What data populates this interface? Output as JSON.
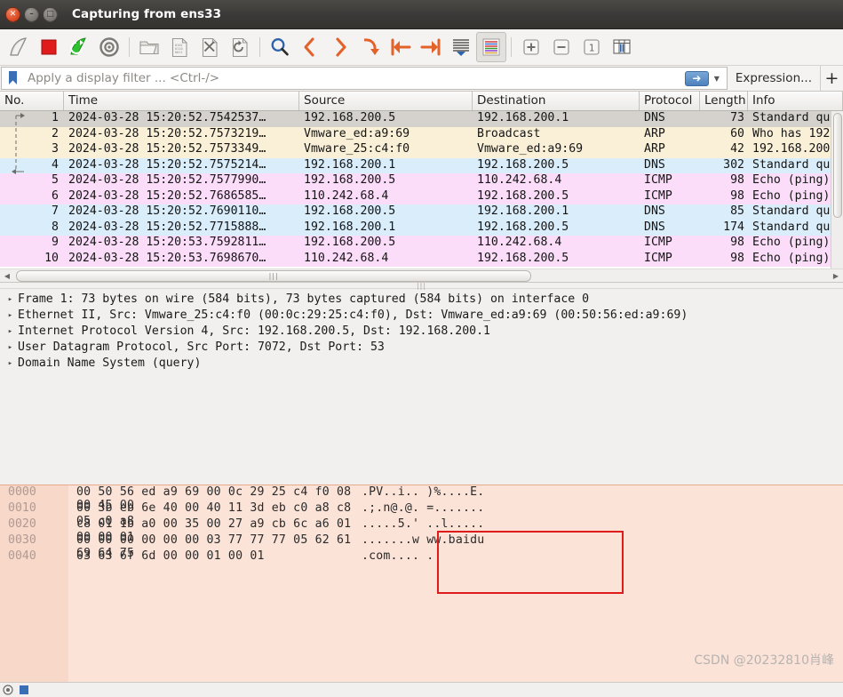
{
  "window": {
    "title": "Capturing from ens33",
    "close_icon": "close-icon",
    "minimize_icon": "minimize-icon",
    "maximize_icon": "maximize-icon"
  },
  "toolbar": {
    "buttons": [
      {
        "name": "start-capture",
        "icon": "shark-fin-icon"
      },
      {
        "name": "stop-capture",
        "icon": "stop-square-icon"
      },
      {
        "name": "restart-capture",
        "icon": "restart-icon"
      },
      {
        "name": "capture-options",
        "icon": "gear-icon"
      },
      {
        "name": "open-file",
        "icon": "folder-icon"
      },
      {
        "name": "save-file",
        "icon": "save-document-icon"
      },
      {
        "name": "close-file",
        "icon": "close-document-icon"
      },
      {
        "name": "reload-file",
        "icon": "reload-icon"
      },
      {
        "name": "find-packet",
        "icon": "magnifier-icon"
      },
      {
        "name": "go-back",
        "icon": "arrow-left-icon"
      },
      {
        "name": "go-forward",
        "icon": "arrow-right-icon"
      },
      {
        "name": "go-to-packet",
        "icon": "arrow-down-curve-icon"
      },
      {
        "name": "go-to-first",
        "icon": "jump-to-start-icon"
      },
      {
        "name": "go-to-last",
        "icon": "jump-to-end-icon"
      },
      {
        "name": "auto-scroll",
        "icon": "auto-scroll-icon"
      },
      {
        "name": "colorize-packets",
        "icon": "colorize-icon"
      },
      {
        "name": "zoom-in",
        "icon": "plus-box-icon"
      },
      {
        "name": "zoom-out",
        "icon": "minus-box-icon"
      },
      {
        "name": "zoom-reset",
        "icon": "one-box-icon"
      },
      {
        "name": "resize-columns",
        "icon": "resize-columns-icon"
      }
    ]
  },
  "filter": {
    "bookmark_icon": "bookmark-icon",
    "value": "",
    "placeholder": "Apply a display filter ... <Ctrl-/>",
    "apply_icon": "arrow-right-icon",
    "dropdown_icon": "chevron-down-icon",
    "expression_label": "Expression...",
    "add_label": "+"
  },
  "packet_list": {
    "columns": [
      "No.",
      "Time",
      "Source",
      "Destination",
      "Protocol",
      "Length",
      "Info"
    ],
    "rows": [
      {
        "no": "1",
        "time": "2024-03-28 15:20:52.7542537…",
        "source": "192.168.200.5",
        "destination": "192.168.200.1",
        "protocol": "DNS",
        "length": "73",
        "info": "Standard qu",
        "style": "r-sel"
      },
      {
        "no": "2",
        "time": "2024-03-28 15:20:52.7573219…",
        "source": "Vmware_ed:a9:69",
        "destination": "Broadcast",
        "protocol": "ARP",
        "length": "60",
        "info": "Who has 192",
        "style": "r-cream"
      },
      {
        "no": "3",
        "time": "2024-03-28 15:20:52.7573349…",
        "source": "Vmware_25:c4:f0",
        "destination": "Vmware_ed:a9:69",
        "protocol": "ARP",
        "length": "42",
        "info": "192.168.200",
        "style": "r-cream"
      },
      {
        "no": "4",
        "time": "2024-03-28 15:20:52.7575214…",
        "source": "192.168.200.1",
        "destination": "192.168.200.5",
        "protocol": "DNS",
        "length": "302",
        "info": "Standard qu",
        "style": "r-blue"
      },
      {
        "no": "5",
        "time": "2024-03-28 15:20:52.7577990…",
        "source": "192.168.200.5",
        "destination": "110.242.68.4",
        "protocol": "ICMP",
        "length": "98",
        "info": "Echo (ping)",
        "style": "r-pink"
      },
      {
        "no": "6",
        "time": "2024-03-28 15:20:52.7686585…",
        "source": "110.242.68.4",
        "destination": "192.168.200.5",
        "protocol": "ICMP",
        "length": "98",
        "info": "Echo (ping)",
        "style": "r-pink"
      },
      {
        "no": "7",
        "time": "2024-03-28 15:20:52.7690110…",
        "source": "192.168.200.5",
        "destination": "192.168.200.1",
        "protocol": "DNS",
        "length": "85",
        "info": "Standard qu",
        "style": "r-blue"
      },
      {
        "no": "8",
        "time": "2024-03-28 15:20:52.7715888…",
        "source": "192.168.200.1",
        "destination": "192.168.200.5",
        "protocol": "DNS",
        "length": "174",
        "info": "Standard qu",
        "style": "r-blue"
      },
      {
        "no": "9",
        "time": "2024-03-28 15:20:53.7592811…",
        "source": "192.168.200.5",
        "destination": "110.242.68.4",
        "protocol": "ICMP",
        "length": "98",
        "info": "Echo (ping)",
        "style": "r-pink"
      },
      {
        "no": "10",
        "time": "2024-03-28 15:20:53.7698670…",
        "source": "110.242.68.4",
        "destination": "192.168.200.5",
        "protocol": "ICMP",
        "length": "98",
        "info": "Echo (ping)",
        "style": "r-pink"
      }
    ]
  },
  "detail_tree": [
    {
      "triangle": "▸",
      "text": "Frame 1: 73 bytes on wire (584 bits), 73 bytes captured (584 bits) on interface 0"
    },
    {
      "triangle": "▸",
      "text": "Ethernet II, Src: Vmware_25:c4:f0 (00:0c:29:25:c4:f0), Dst: Vmware_ed:a9:69 (00:50:56:ed:a9:69)"
    },
    {
      "triangle": "▸",
      "text": "Internet Protocol Version 4, Src: 192.168.200.5, Dst: 192.168.200.1"
    },
    {
      "triangle": "▸",
      "text": "User Datagram Protocol, Src Port: 7072, Dst Port: 53"
    },
    {
      "triangle": "▸",
      "text": "Domain Name System (query)"
    }
  ],
  "hex_dump": [
    {
      "offset": "0000",
      "bytes": "00 50 56 ed a9 69 00 0c   29 25 c4 f0 08 00 45 00",
      "ascii": ".PV..i.. )%....E."
    },
    {
      "offset": "0010",
      "bytes": "00 3b eb 6e 40 00 40 11   3d eb c0 a8 c8 05 c0 a8",
      "ascii": ".;.n@.@. =......."
    },
    {
      "offset": "0020",
      "bytes": "c8 01 1b a0 00 35 00 27   a9 cb 6c a6 01 00 00 01",
      "ascii": ".....5.' ..l....."
    },
    {
      "offset": "0030",
      "bytes": "00 00 00 00 00 00 03 77   77 77 05 62 61 69 64 75",
      "ascii": ".......w ww.baidu"
    },
    {
      "offset": "0040",
      "bytes": "03 63 6f 6d 00 00 01 00   01",
      "ascii": ".com.... ."
    }
  ],
  "annotation": {
    "box_color": "#e01b1b",
    "name": "red-highlight-box"
  },
  "watermark": {
    "text": "CSDN @20232810肖峰"
  },
  "status_bar": {
    "capture_icon": "capture-status-icon",
    "expert_icon": "expert-info-icon",
    "text": "",
    "right_text": "",
    "profile": ""
  }
}
